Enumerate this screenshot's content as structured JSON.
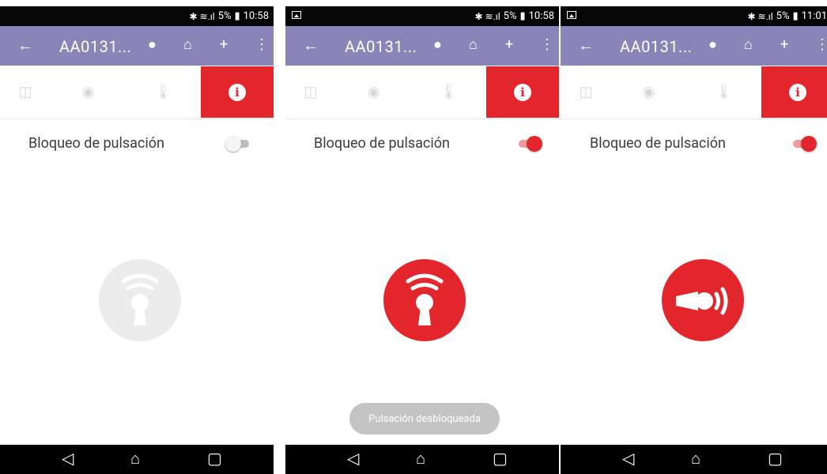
{
  "screens": [
    {
      "status": {
        "signal_icons": "✱ ≋.ıl",
        "battery": "5%",
        "time": "10:58",
        "show_thumbnail": false
      },
      "appbar": {
        "title": "AA0131..."
      },
      "setting": {
        "label": "Bloqueo de pulsación",
        "enabled": false
      },
      "main_button": {
        "state": "locked",
        "color": "#ececec",
        "icon": "keyhole-wifi-icon"
      }
    },
    {
      "status": {
        "signal_icons": "✱ ≋.ıl",
        "battery": "5%",
        "time": "10:58",
        "show_thumbnail": true
      },
      "appbar": {
        "title": "AA0131..."
      },
      "setting": {
        "label": "Bloqueo de pulsación",
        "enabled": true
      },
      "main_button": {
        "state": "unlocked",
        "color": "#e3262b",
        "icon": "keyhole-wifi-icon"
      },
      "toast": {
        "text": "Pulsación desbloqueada"
      }
    },
    {
      "status": {
        "signal_icons": "✱ ≋.ıl",
        "battery": "5%",
        "time": "11:01",
        "show_thumbnail": true
      },
      "appbar": {
        "title": "AA0131..."
      },
      "setting": {
        "label": "Bloqueo de pulsación",
        "enabled": true
      },
      "main_button": {
        "state": "active",
        "color": "#e3262b",
        "icon": "key-signal-icon"
      }
    }
  ],
  "colors": {
    "accent": "#e3262b",
    "appbar": "#8b84b8",
    "toast": "#c4c4c4"
  },
  "tabs": [
    "door-icon",
    "eye-icon",
    "thermometer-icon",
    "info-icon"
  ],
  "navbar": [
    "back-triangle-icon",
    "home-icon",
    "recents-icon"
  ]
}
